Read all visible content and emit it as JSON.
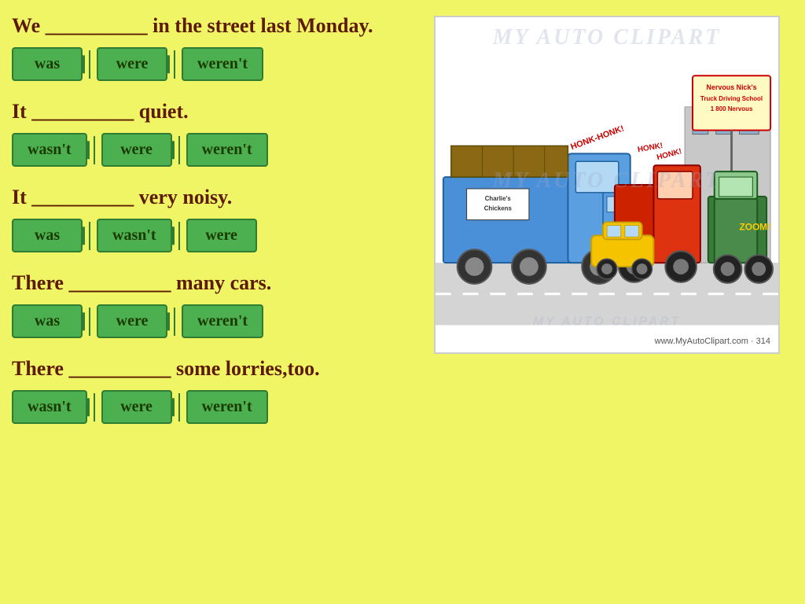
{
  "background_color": "#f0f566",
  "questions": [
    {
      "id": "q1",
      "text": "We __________ in the street last Monday.",
      "options": [
        "was",
        "were",
        "weren't"
      ]
    },
    {
      "id": "q2",
      "text": "It __________ quiet.",
      "options": [
        "wasn't",
        "were",
        "weren't"
      ]
    },
    {
      "id": "q3",
      "text": "It __________ very noisy.",
      "options": [
        "was",
        "wasn't",
        "were"
      ]
    },
    {
      "id": "q4",
      "text": "There __________ many cars.",
      "options": [
        "was",
        "were",
        "weren't"
      ]
    },
    {
      "id": "q5",
      "text": "There __________ some lorries,too.",
      "options": [
        "wasn't",
        "were",
        "weren't"
      ]
    }
  ],
  "clipart": {
    "watermark_text": "MY AUTO CLIPART",
    "credit": "www.MyAutoClipart.com · 314",
    "school_sign": "Nervous Nick's\nTruck Driving School\n1 800 Nervous"
  }
}
